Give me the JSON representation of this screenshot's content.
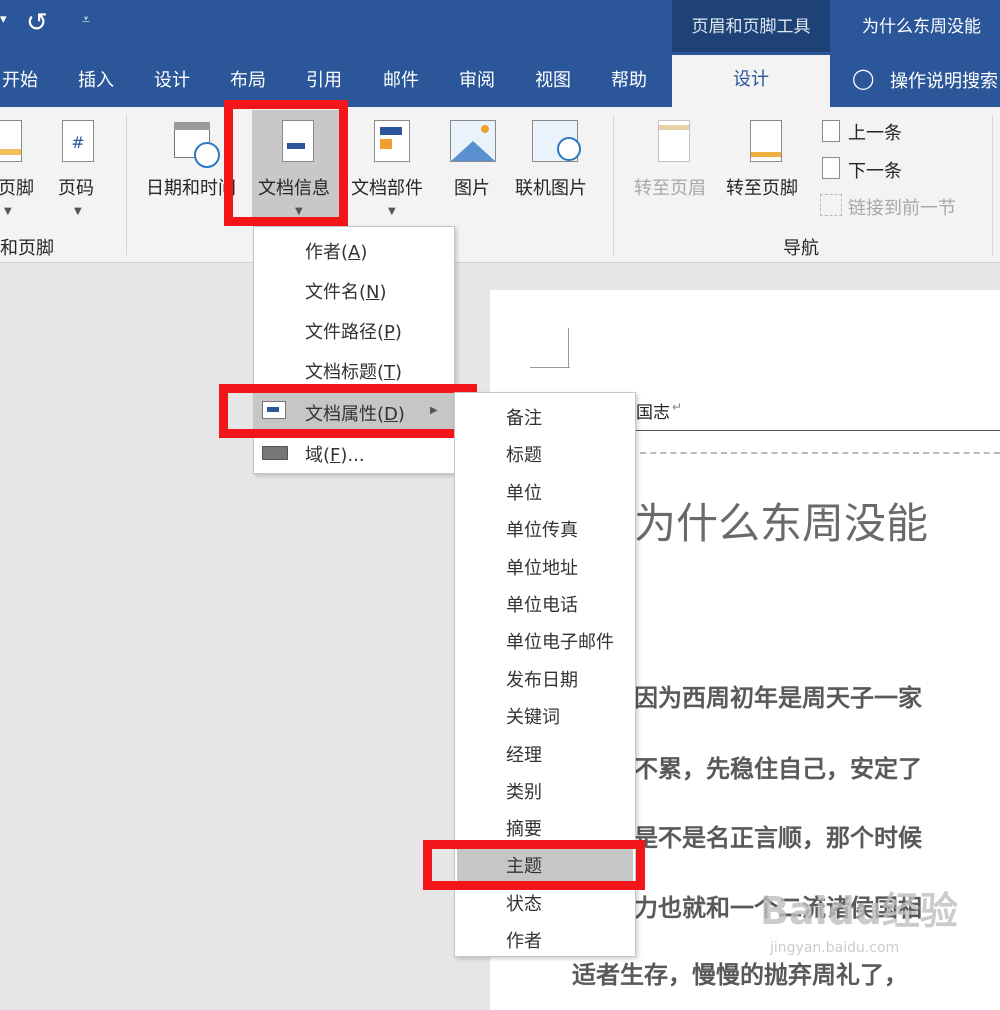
{
  "titlebar": {
    "qat_arrow": "▾",
    "undo_icon": "undo-icon",
    "qat_more": "⩡",
    "context_group": "页眉和页脚工具",
    "doc_title": "为什么东周没能"
  },
  "tabs": [
    "开始",
    "插入",
    "设计",
    "布局",
    "引用",
    "邮件",
    "审阅",
    "视图",
    "帮助"
  ],
  "active_tab": "设计",
  "tell_me": "操作说明搜索",
  "ribbon": {
    "footer_btn": "页脚",
    "page_number_btn": "页码",
    "group1_label": "和页脚",
    "datetime_btn": "日期和时间",
    "docinfo_btn": "文档信息",
    "docparts_btn": "文档部件",
    "picture_btn": "图片",
    "online_picture_btn": "联机图片",
    "goto_header_btn": "转至页眉",
    "goto_footer_btn": "转至页脚",
    "previous_btn": "上一条",
    "next_btn": "下一条",
    "link_previous_btn": "链接到前一节",
    "nav_group_label": "导航"
  },
  "docinfo_menu": {
    "items": [
      {
        "label": "作者",
        "key": "A"
      },
      {
        "label": "文件名",
        "key": "N"
      },
      {
        "label": "文件路径",
        "key": "P"
      },
      {
        "label": "文档标题",
        "key": "T"
      },
      {
        "label": "文档属性",
        "key": "D"
      },
      {
        "label": "域",
        "key": "F",
        "suffix": "..."
      }
    ]
  },
  "properties_submenu": {
    "items": [
      "备注",
      "标题",
      "单位",
      "单位传真",
      "单位地址",
      "单位电话",
      "单位电子邮件",
      "发布日期",
      "关键词",
      "经理",
      "类别",
      "摘要",
      "主题",
      "状态",
      "作者"
    ],
    "highlighted": "主题"
  },
  "document": {
    "header_text": "国志",
    "title": "为什么东周没能",
    "lines": [
      "因为西周初年是周天子一家",
      "不累，先稳住自己，安定了",
      "是不是名正言顺，那个时候",
      "力也就和一个二流诸侯国相",
      "适者生存，慢慢的抛弃周礼了，"
    ]
  },
  "watermark": {
    "main": "Baidu经验",
    "sub": "jingyan.baidu.com"
  },
  "colors": {
    "word_blue": "#2b579a",
    "highlight_red": "#f2151a",
    "ribbon_bg": "#f3f3f3"
  }
}
